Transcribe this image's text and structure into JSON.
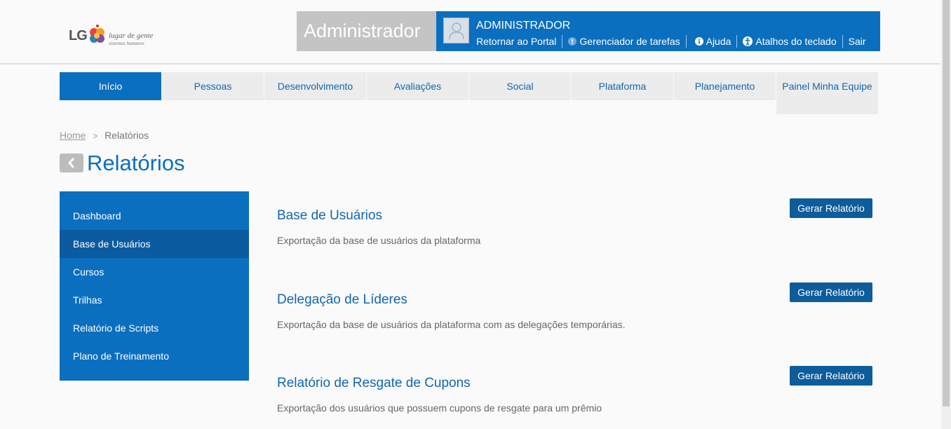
{
  "header": {
    "logo_text": "LG",
    "logo_tagline": "lugar de gente",
    "logo_subtagline": "sistemas humanos",
    "role": "Administrador",
    "user_name": "ADMINISTRADOR",
    "links": [
      {
        "label": "Retornar ao Portal",
        "icon": ""
      },
      {
        "label": "Gerenciador de tarefas",
        "icon": "info-circle-icon"
      },
      {
        "label": "Ajuda",
        "icon": "info-icon"
      },
      {
        "label": "Atalhos do teclado",
        "icon": "accessibility-icon"
      },
      {
        "label": "Sair",
        "icon": ""
      }
    ]
  },
  "nav": {
    "tabs": [
      {
        "label": "Início",
        "active": true
      },
      {
        "label": "Pessoas"
      },
      {
        "label": "Desenvolvimento"
      },
      {
        "label": "Avaliações"
      },
      {
        "label": "Social"
      },
      {
        "label": "Plataforma"
      },
      {
        "label": "Planejamento"
      },
      {
        "label": "Painel Minha Equipe"
      }
    ]
  },
  "breadcrumb": {
    "home": "Home",
    "separator": ">",
    "current": "Relatórios"
  },
  "page": {
    "title": "Relatórios"
  },
  "sidebar": {
    "items": [
      {
        "label": "Dashboard"
      },
      {
        "label": "Base de Usuários",
        "active": true
      },
      {
        "label": "Cursos"
      },
      {
        "label": "Trilhas"
      },
      {
        "label": "Relatório de Scripts"
      },
      {
        "label": "Plano de Treinamento"
      }
    ]
  },
  "reports": [
    {
      "title": "Base de Usuários",
      "description": "Exportação da base de usuários da plataforma",
      "button": "Gerar Relatório"
    },
    {
      "title": "Delegação de Líderes",
      "description": "Exportação da base de usuários da plataforma com as delegações temporárias.",
      "button": "Gerar Relatório"
    },
    {
      "title": "Relatório de Resgate de Cupons",
      "description": "Exportação dos usuários que possuem cupons de resgate para um prêmio",
      "button": "Gerar Relatório"
    }
  ],
  "colors": {
    "primary": "#0b6fbf",
    "sidebar_active": "#0a5ba0",
    "button": "#0d5c9c",
    "role_box": "#c4c4c4"
  }
}
